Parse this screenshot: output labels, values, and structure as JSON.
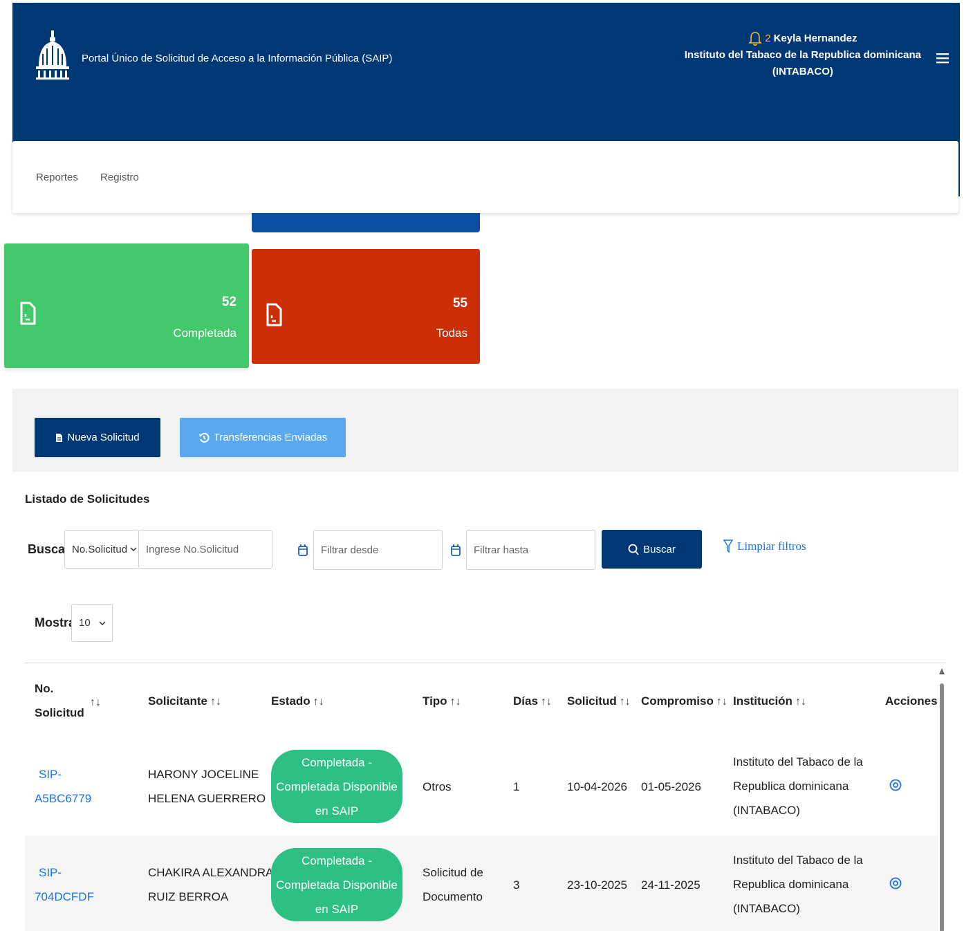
{
  "header": {
    "title": "Portal Único de Solicitud de Acceso a la Información Pública (SAIP)",
    "notification_count": "2",
    "user_name": "Keyla Hernandez",
    "institution_line1": "Instituto del Tabaco de la Republica dominicana",
    "institution_line2": "(INTABACO)",
    "bg_color": "#003876"
  },
  "nav": {
    "items": [
      {
        "label": "Reportes"
      },
      {
        "label": "Registro"
      }
    ]
  },
  "stats": [
    {
      "value": "52",
      "label": "Completada",
      "color": "#43c96c"
    },
    {
      "value": "55",
      "label": "Todas",
      "color": "#cc2e08"
    }
  ],
  "actions": {
    "nueva_label": "Nueva Solicitud",
    "transferencias_label": "Transferencias Enviadas"
  },
  "listing": {
    "title": "Listado de Solicitudes",
    "search_label": "Buscar:",
    "search_type_value": "No.Solicitud",
    "search_placeholder": "Ingrese No.Solicitud",
    "desde_placeholder": "Filtrar desde",
    "hasta_placeholder": "Filtrar hasta",
    "buscar_label": "Buscar",
    "limpiar_label": "Limpiar filtros",
    "mostrar_label": "Mostrar",
    "mostrar_value": "10"
  },
  "table": {
    "columns": [
      {
        "line1": "No.",
        "line2": "Solicitud"
      },
      {
        "label": "Solicitante"
      },
      {
        "label": "Estado"
      },
      {
        "label": "Tipo"
      },
      {
        "label": "Días"
      },
      {
        "label": "Solicitud"
      },
      {
        "label": "Compromiso"
      },
      {
        "label": "Institución"
      },
      {
        "label": "Acciones"
      }
    ],
    "sort_glyph": "↑↓",
    "rows": [
      {
        "no_line1": "SIP-",
        "no_line2": "A5BC6779",
        "solicitante_line1": "HARONY JOCELINE",
        "solicitante_line2": "HELENA GUERRERO",
        "estado_line1": "Completada -",
        "estado_line2": "Completada Disponible",
        "estado_line3": "en SAIP",
        "tipo_line1": "Otros",
        "tipo_line2": "",
        "dias": "1",
        "solicitud": "10-04-2026",
        "compromiso": "01-05-2026",
        "inst_line1": "Instituto del Tabaco de la",
        "inst_line2": "Republica dominicana",
        "inst_line3": "(INTABACO)"
      },
      {
        "no_line1": "SIP-",
        "no_line2": "704DCFDF",
        "solicitante_line1": "CHAKIRA ALEXANDRA",
        "solicitante_line2": "RUIZ BERROA",
        "estado_line1": "Completada -",
        "estado_line2": "Completada Disponible",
        "estado_line3": "en SAIP",
        "tipo_line1": "Solicitud de",
        "tipo_line2": "Documento",
        "dias": "3",
        "solicitud": "23-10-2025",
        "compromiso": "24-11-2025",
        "inst_line1": "Instituto del Tabaco de la",
        "inst_line2": "Republica dominicana",
        "inst_line3": "(INTABACO)"
      }
    ]
  }
}
